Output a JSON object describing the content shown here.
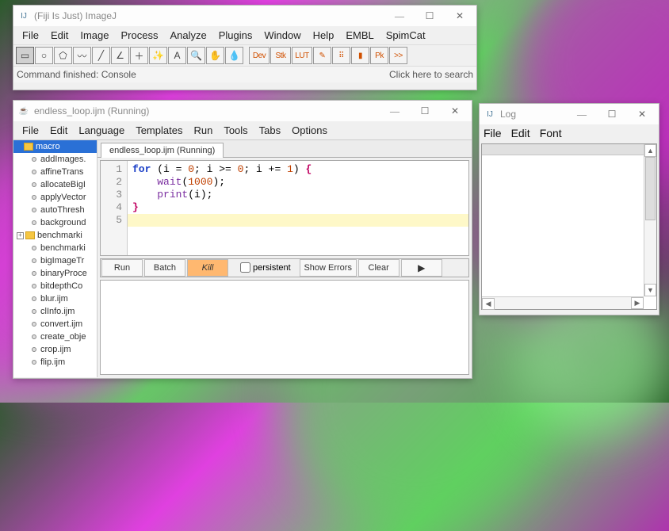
{
  "imagej": {
    "title": "(Fiji Is Just) ImageJ",
    "menu": [
      "File",
      "Edit",
      "Image",
      "Process",
      "Analyze",
      "Plugins",
      "Window",
      "Help",
      "EMBL",
      "SpimCat"
    ],
    "status_left": "Command finished: Console",
    "status_right": "Click here to search",
    "tool_icons": [
      "rect",
      "oval",
      "poly",
      "freehand",
      "line",
      "angle",
      "crosshair",
      "wand",
      "text",
      "magnifier",
      "hand",
      "dropper"
    ],
    "ext_buttons": [
      "Dev",
      "Stk",
      "LUT"
    ],
    "ext_icons": [
      "pencil",
      "spray",
      "paint",
      "pk",
      "more"
    ]
  },
  "editor": {
    "title": "endless_loop.ijm (Running)",
    "menu": [
      "File",
      "Edit",
      "Language",
      "Templates",
      "Run",
      "Tools",
      "Tabs",
      "Options"
    ],
    "tab_label": "endless_loop.ijm (Running)",
    "tree": {
      "root": "macro",
      "expandable": "benchmarki",
      "items": [
        "addImages.",
        "affineTrans",
        "allocateBigI",
        "applyVector",
        "autoThresh",
        "background",
        "benchmarki",
        "benchmarki",
        "bigImageTr",
        "binaryProce",
        "bitdepthCo",
        "blur.ijm",
        "clInfo.ijm",
        "convert.ijm",
        "create_obje",
        "crop.ijm",
        "flip.ijm"
      ]
    },
    "code": {
      "lines": [
        {
          "n": "1",
          "raw": "for (i = 0; i >= 0; i += 1) {"
        },
        {
          "n": "2",
          "raw": "    wait(1000);"
        },
        {
          "n": "3",
          "raw": "    print(i);"
        },
        {
          "n": "4",
          "raw": "}"
        },
        {
          "n": "5",
          "raw": ""
        }
      ],
      "highlight_line": 5
    },
    "buttons": {
      "run": "Run",
      "batch": "Batch",
      "kill": "Kill",
      "persistent": "persistent",
      "show_errors": "Show Errors",
      "clear": "Clear"
    }
  },
  "log": {
    "title": "Log",
    "menu": [
      "File",
      "Edit",
      "Font"
    ]
  }
}
